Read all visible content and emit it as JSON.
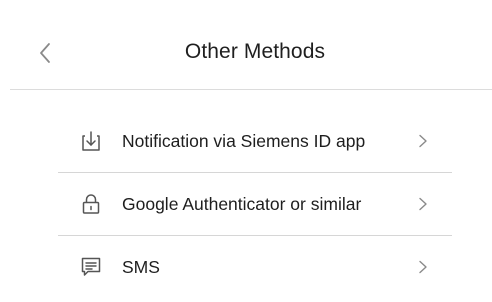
{
  "header": {
    "title": "Other Methods",
    "back_icon": "chevron-left-icon"
  },
  "methods": [
    {
      "label": "Notification via Siemens ID app",
      "icon": "download-icon"
    },
    {
      "label": "Google Authenticator or similar",
      "icon": "lock-icon"
    },
    {
      "label": "SMS",
      "icon": "message-icon"
    }
  ],
  "colors": {
    "text": "#1e1e1e",
    "icon": "#555555",
    "chevron": "#8a8a8a",
    "divider": "#d6d6d6"
  }
}
